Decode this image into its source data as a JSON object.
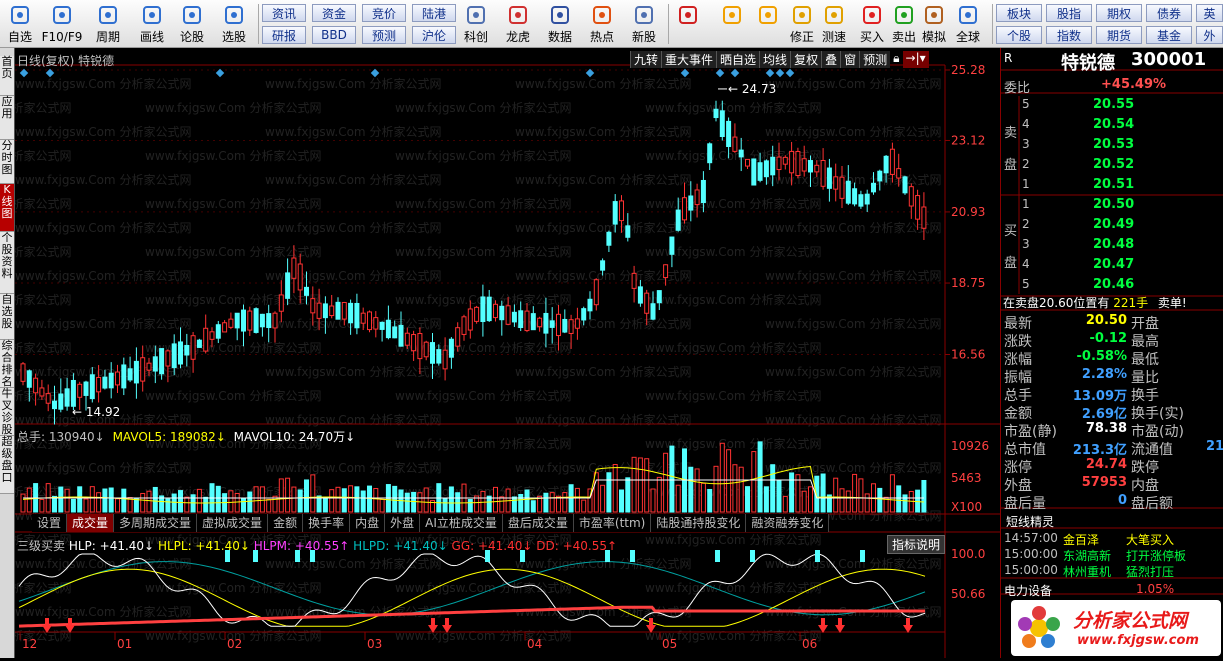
{
  "toolbar": {
    "items": [
      {
        "label": "自选",
        "icon": "star-icon"
      },
      {
        "label": "F10/F9",
        "icon": "document-icon"
      },
      {
        "label": "周期",
        "icon": "clock-icon"
      },
      {
        "label": "画线",
        "icon": "pen-icon"
      },
      {
        "label": "论股",
        "icon": "forum-icon"
      },
      {
        "label": "选股",
        "icon": "pick-stock-icon"
      }
    ],
    "buttons_top": [
      "资讯",
      "资金",
      "竞价",
      "陆港"
    ],
    "buttons_bottom": [
      "研报",
      "BBD",
      "预测",
      "沪伦"
    ],
    "items2": [
      {
        "label": "科创",
        "icon": "chart-icon"
      },
      {
        "label": "龙虎",
        "icon": "dragon-icon"
      },
      {
        "label": "数据",
        "icon": "pe-icon"
      },
      {
        "label": "热点",
        "icon": "fire-icon"
      },
      {
        "label": "新股",
        "icon": "new-stock-icon"
      }
    ],
    "items3": [
      {
        "label": "",
        "icon": "grid-icon"
      },
      {
        "label": "",
        "icon": "back-arrow-icon"
      },
      {
        "label": "",
        "icon": "updown-icon"
      },
      {
        "label": "修正",
        "icon": "fix-icon"
      },
      {
        "label": "测速",
        "icon": "speed-icon"
      },
      {
        "label": "买入",
        "icon": "buy-icon"
      },
      {
        "label": "卖出",
        "icon": "sell-icon"
      },
      {
        "label": "模拟",
        "icon": "hammer-icon"
      },
      {
        "label": "全球",
        "icon": "globe-icon"
      }
    ],
    "right_top": [
      "板块",
      "股指",
      "期权",
      "债券",
      "英"
    ],
    "right_bottom": [
      "个股",
      "指数",
      "期货",
      "基金",
      "外"
    ]
  },
  "left_tabs": [
    "首页",
    "应用",
    "分时图",
    "K线图",
    "个股资料",
    "自选股",
    "综合排名",
    "牛叉诊股",
    "超级盘口"
  ],
  "chart": {
    "header_title": "日线(复权) 特锐德",
    "header_tools": [
      "九转",
      "重大事件",
      "晒自选",
      "均线",
      "复权",
      "叠",
      "窗",
      "预测"
    ],
    "price_ticks": [
      "25.28",
      "23.12",
      "20.93",
      "18.75",
      "16.56"
    ],
    "max_label": "24.73",
    "min_label": "14.92",
    "vol_header": {
      "total": "总手: 130940↓",
      "ma5": "MAVOL5: 189082↓",
      "ma10": "MAVOL10: 24.70万↓"
    },
    "vol_ticks": [
      "10926",
      "5463",
      "X100"
    ],
    "tabs": [
      "设置",
      "成交量",
      "多周期成交量",
      "虚拟成交量",
      "金额",
      "换手率",
      "内盘",
      "外盘",
      "AI立桩成交量",
      "盘后成交量",
      "市盈率(ttm)",
      "陆股通持股变化",
      "融资融券变化"
    ],
    "ind_header": {
      "name": "三级买卖",
      "hlp": "HLP: +41.40↓",
      "hlpl": "HLPL: +41.40↓",
      "hlpm": "HLPM: +40.55↑",
      "hlpd": "HLPD: +41.40↓",
      "gg": "GG: +41.40↓",
      "dd": "DD: +40.55↑"
    },
    "ind_button": "指标说明",
    "ind_ticks": [
      "100.0",
      "50.66"
    ],
    "months": [
      "12",
      "01",
      "02",
      "03",
      "04",
      "05",
      "06"
    ],
    "watermark": "www.fxjgsw.Com 分析家公式网"
  },
  "chart_data": {
    "type": "candlestick",
    "ylim": [
      14.92,
      25.28
    ],
    "note": "daily K-line of 特锐德 300001 with volume and 三级买卖 indicator",
    "high": 24.73,
    "low": 14.92
  },
  "quote": {
    "name": "特锐德",
    "code": "300001",
    "r": "R",
    "weibi_label": "委比",
    "weibi": "+45.49%",
    "sell_label": "卖盘",
    "buy_label": "买盘",
    "asks": [
      {
        "n": "5",
        "p": "20.55"
      },
      {
        "n": "4",
        "p": "20.54"
      },
      {
        "n": "3",
        "p": "20.53"
      },
      {
        "n": "2",
        "p": "20.52"
      },
      {
        "n": "1",
        "p": "20.51"
      }
    ],
    "bids": [
      {
        "n": "1",
        "p": "20.50"
      },
      {
        "n": "2",
        "p": "20.49"
      },
      {
        "n": "3",
        "p": "20.48"
      },
      {
        "n": "4",
        "p": "20.47"
      },
      {
        "n": "5",
        "p": "20.46"
      }
    ],
    "sell_order": "在卖盘20.60位置有",
    "sell_qty": "221手",
    "sell_tag": "卖单!",
    "rows": [
      [
        "最新",
        "20.50",
        "开盘",
        ""
      ],
      [
        "涨跌",
        "-0.12",
        "最高",
        ""
      ],
      [
        "涨幅",
        "-0.58%",
        "最低",
        ""
      ],
      [
        "振幅",
        "2.28%",
        "量比",
        ""
      ],
      [
        "总手",
        "13.09万",
        "换手",
        ""
      ],
      [
        "金额",
        "2.69亿",
        "换手(实)",
        ""
      ],
      [
        "市盈(静)",
        "78.38",
        "市盈(动)",
        ""
      ],
      [
        "总市值",
        "213.3亿",
        "流通值",
        "21"
      ],
      [
        "涨停",
        "24.74",
        "跌停",
        ""
      ],
      [
        "外盘",
        "57953",
        "内盘",
        ""
      ],
      [
        "盘后量",
        "0",
        "盘后额",
        ""
      ]
    ],
    "short_title": "短线精灵",
    "short": [
      [
        "14:57:00",
        "金百泽",
        "大笔买入"
      ],
      [
        "15:00:00",
        "东湖高新",
        "打开涨停板"
      ],
      [
        "15:00:00",
        "林州重机",
        "猛烈打压"
      ]
    ],
    "sector": "电力设备",
    "sector_pct": "1.05%",
    "logo": "分析家公式网",
    "logo_url": "www.fxjgsw.com"
  }
}
